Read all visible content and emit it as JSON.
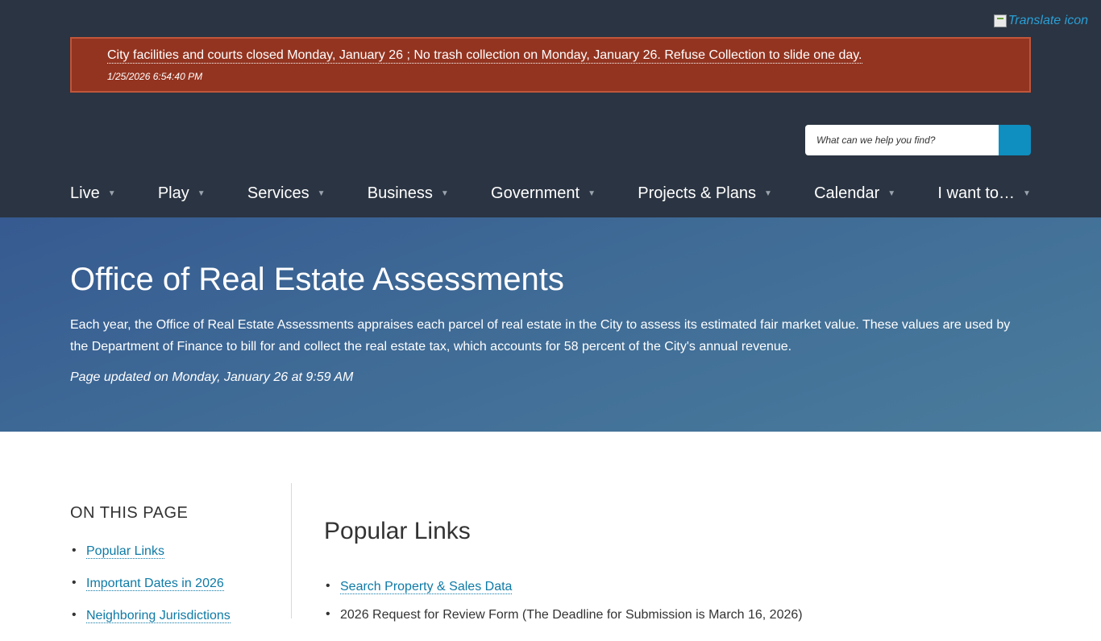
{
  "translate": {
    "alt_text": "Translate icon"
  },
  "alert": {
    "message": "City facilities and courts closed Monday, January 26 ; No trash collection on Monday, January 26. Refuse Collection to slide one day.",
    "timestamp": "1/25/2026 6:54:40 PM"
  },
  "search": {
    "placeholder": "What can we help you find?"
  },
  "nav": {
    "items": [
      {
        "label": "Live"
      },
      {
        "label": "Play"
      },
      {
        "label": "Services"
      },
      {
        "label": "Business"
      },
      {
        "label": "Government"
      },
      {
        "label": "Projects & Plans"
      },
      {
        "label": "Calendar"
      },
      {
        "label": "I want to…"
      }
    ],
    "caret": "▼"
  },
  "hero": {
    "title": "Office of Real Estate Assessments",
    "description": "Each year, the Office of Real Estate Assessments appraises each parcel of real estate in the City to assess its estimated fair market value. These values are used by the Department of Finance to bill for and collect the real estate tax, which accounts for 58 percent of the City's annual revenue.",
    "updated": "Page updated on Monday, January 26 at 9:59 AM"
  },
  "sidebar": {
    "heading": "ON THIS PAGE",
    "links": [
      {
        "label": "Popular Links"
      },
      {
        "label": "Important Dates in 2026"
      },
      {
        "label": "Neighboring Jurisdictions"
      }
    ]
  },
  "main": {
    "heading": "Popular Links",
    "links": [
      {
        "label": "Search Property & Sales Data"
      },
      {
        "label": "2026 Request for Review Form (The Deadline for Submission is March 16, 2026)"
      }
    ]
  },
  "colors": {
    "header_bg": "#2b3442",
    "alert_bg": "#933420",
    "search_button": "#0f8fc0",
    "link": "#0e7aa6"
  }
}
